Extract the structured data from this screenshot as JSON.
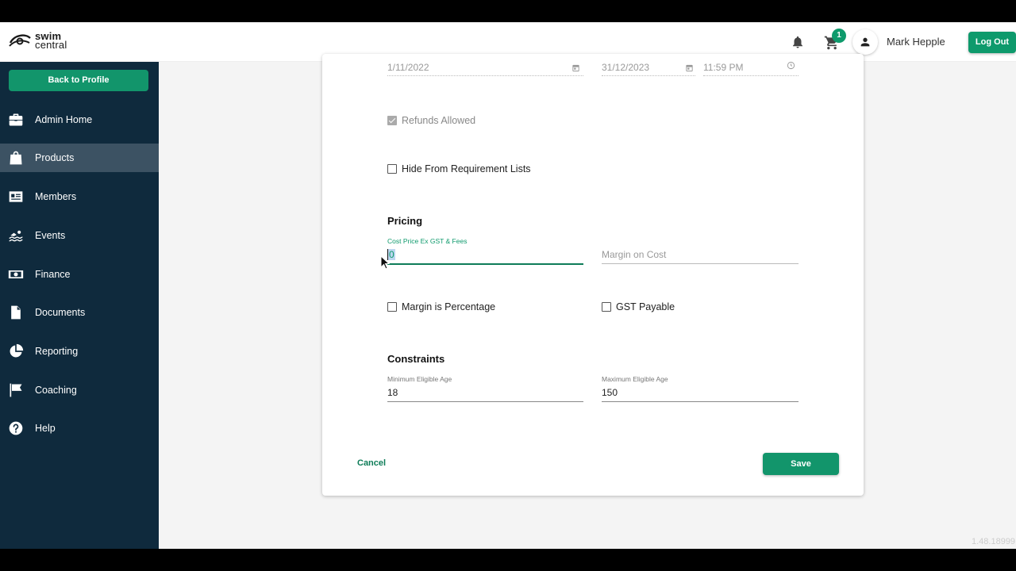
{
  "header": {
    "logo_line1": "swim",
    "logo_line2": "central",
    "cart_count": "1",
    "user_name": "Mark Hepple",
    "logout_label": "Log Out"
  },
  "sidebar": {
    "back_label": "Back to Profile",
    "items": [
      {
        "label": "Admin Home",
        "icon": "briefcase-icon"
      },
      {
        "label": "Products",
        "icon": "shopping-bag-icon",
        "active": true
      },
      {
        "label": "Members",
        "icon": "id-card-icon"
      },
      {
        "label": "Events",
        "icon": "swimmer-icon"
      },
      {
        "label": "Finance",
        "icon": "money-icon"
      },
      {
        "label": "Documents",
        "icon": "document-icon"
      },
      {
        "label": "Reporting",
        "icon": "pie-chart-icon"
      },
      {
        "label": "Coaching",
        "icon": "flag-icon"
      },
      {
        "label": "Help",
        "icon": "help-icon"
      }
    ]
  },
  "form": {
    "start_date": "1/11/2022",
    "end_date": "31/12/2023",
    "end_time": "11:59 PM",
    "refunds_allowed_label": "Refunds Allowed",
    "refunds_allowed_checked": true,
    "hide_requirement_label": "Hide From Requirement Lists",
    "pricing_title": "Pricing",
    "cost_price_label": "Cost Price Ex GST & Fees",
    "cost_price_value": "0",
    "margin_placeholder": "Margin on Cost",
    "margin_pct_label": "Margin is Percentage",
    "gst_label": "GST Payable",
    "constraints_title": "Constraints",
    "min_age_label": "Minimum Eligible Age",
    "min_age_value": "18",
    "max_age_label": "Maximum Eligible Age",
    "max_age_value": "150",
    "cancel_label": "Cancel",
    "save_label": "Save"
  },
  "version": "1.48.18999",
  "colors": {
    "accent": "#0e9a6c",
    "sidebar_bg": "#0f2a3d",
    "sidebar_active": "#3c5263"
  }
}
